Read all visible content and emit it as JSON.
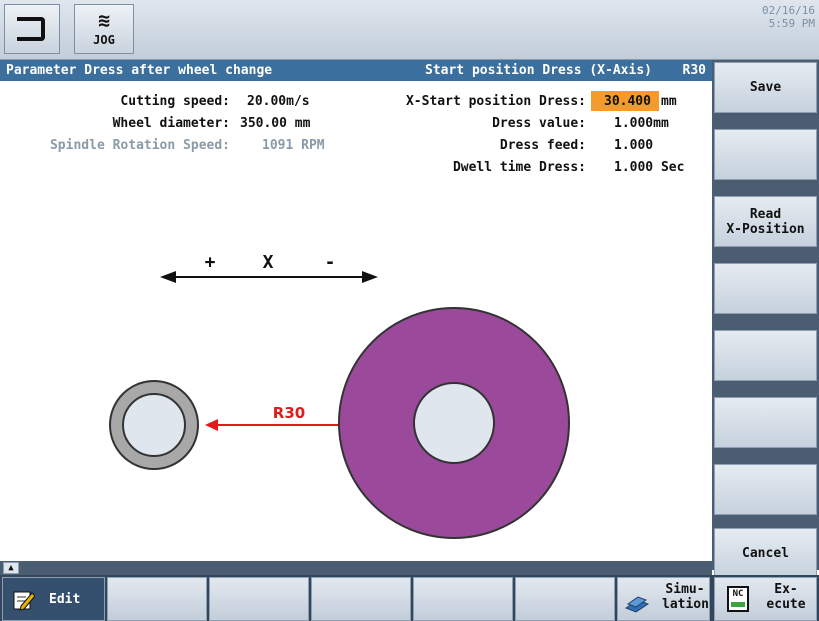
{
  "topbar": {
    "jog_label": "JOG",
    "date": "02/16/16",
    "time": "5:59 PM"
  },
  "header": {
    "left": "Parameter Dress after wheel change",
    "middle": "Start position Dress (X-Axis)",
    "right": "R30"
  },
  "params_left": [
    {
      "label": "Cutting speed:",
      "value": "20.00",
      "unit": "m/s"
    },
    {
      "label": "Wheel diameter:",
      "value": "350.00",
      "unit": "mm"
    },
    {
      "label": "Spindle Rotation Speed:",
      "value": "1091",
      "unit": "RPM"
    }
  ],
  "params_right": [
    {
      "label": "X-Start position Dress:",
      "value": "30.400",
      "unit": "mm"
    },
    {
      "label": "Dress value:",
      "value": "1.000",
      "unit": "mm"
    },
    {
      "label": "Dress feed:",
      "value": "1.000",
      "unit": ""
    },
    {
      "label": "Dwell time Dress:",
      "value": "1.000",
      "unit": "Sec"
    }
  ],
  "diagram": {
    "plus": "+",
    "axis": "X",
    "minus": "-",
    "radius_label": "R30",
    "colors": {
      "wheel": "#9b4a9b",
      "ring": "#a8a8a8",
      "arrow": "#e01b1b",
      "highlight": "#f59b2c"
    }
  },
  "softkeys": {
    "save": "Save",
    "read_x_line1": "Read",
    "read_x_line2": "X-Position",
    "cancel": "Cancel"
  },
  "bottom": {
    "edit": "Edit",
    "simulation_1": "Simu-",
    "simulation_2": "lation",
    "execute_1": "Ex-",
    "execute_2": "ecute",
    "nc": "NC"
  }
}
